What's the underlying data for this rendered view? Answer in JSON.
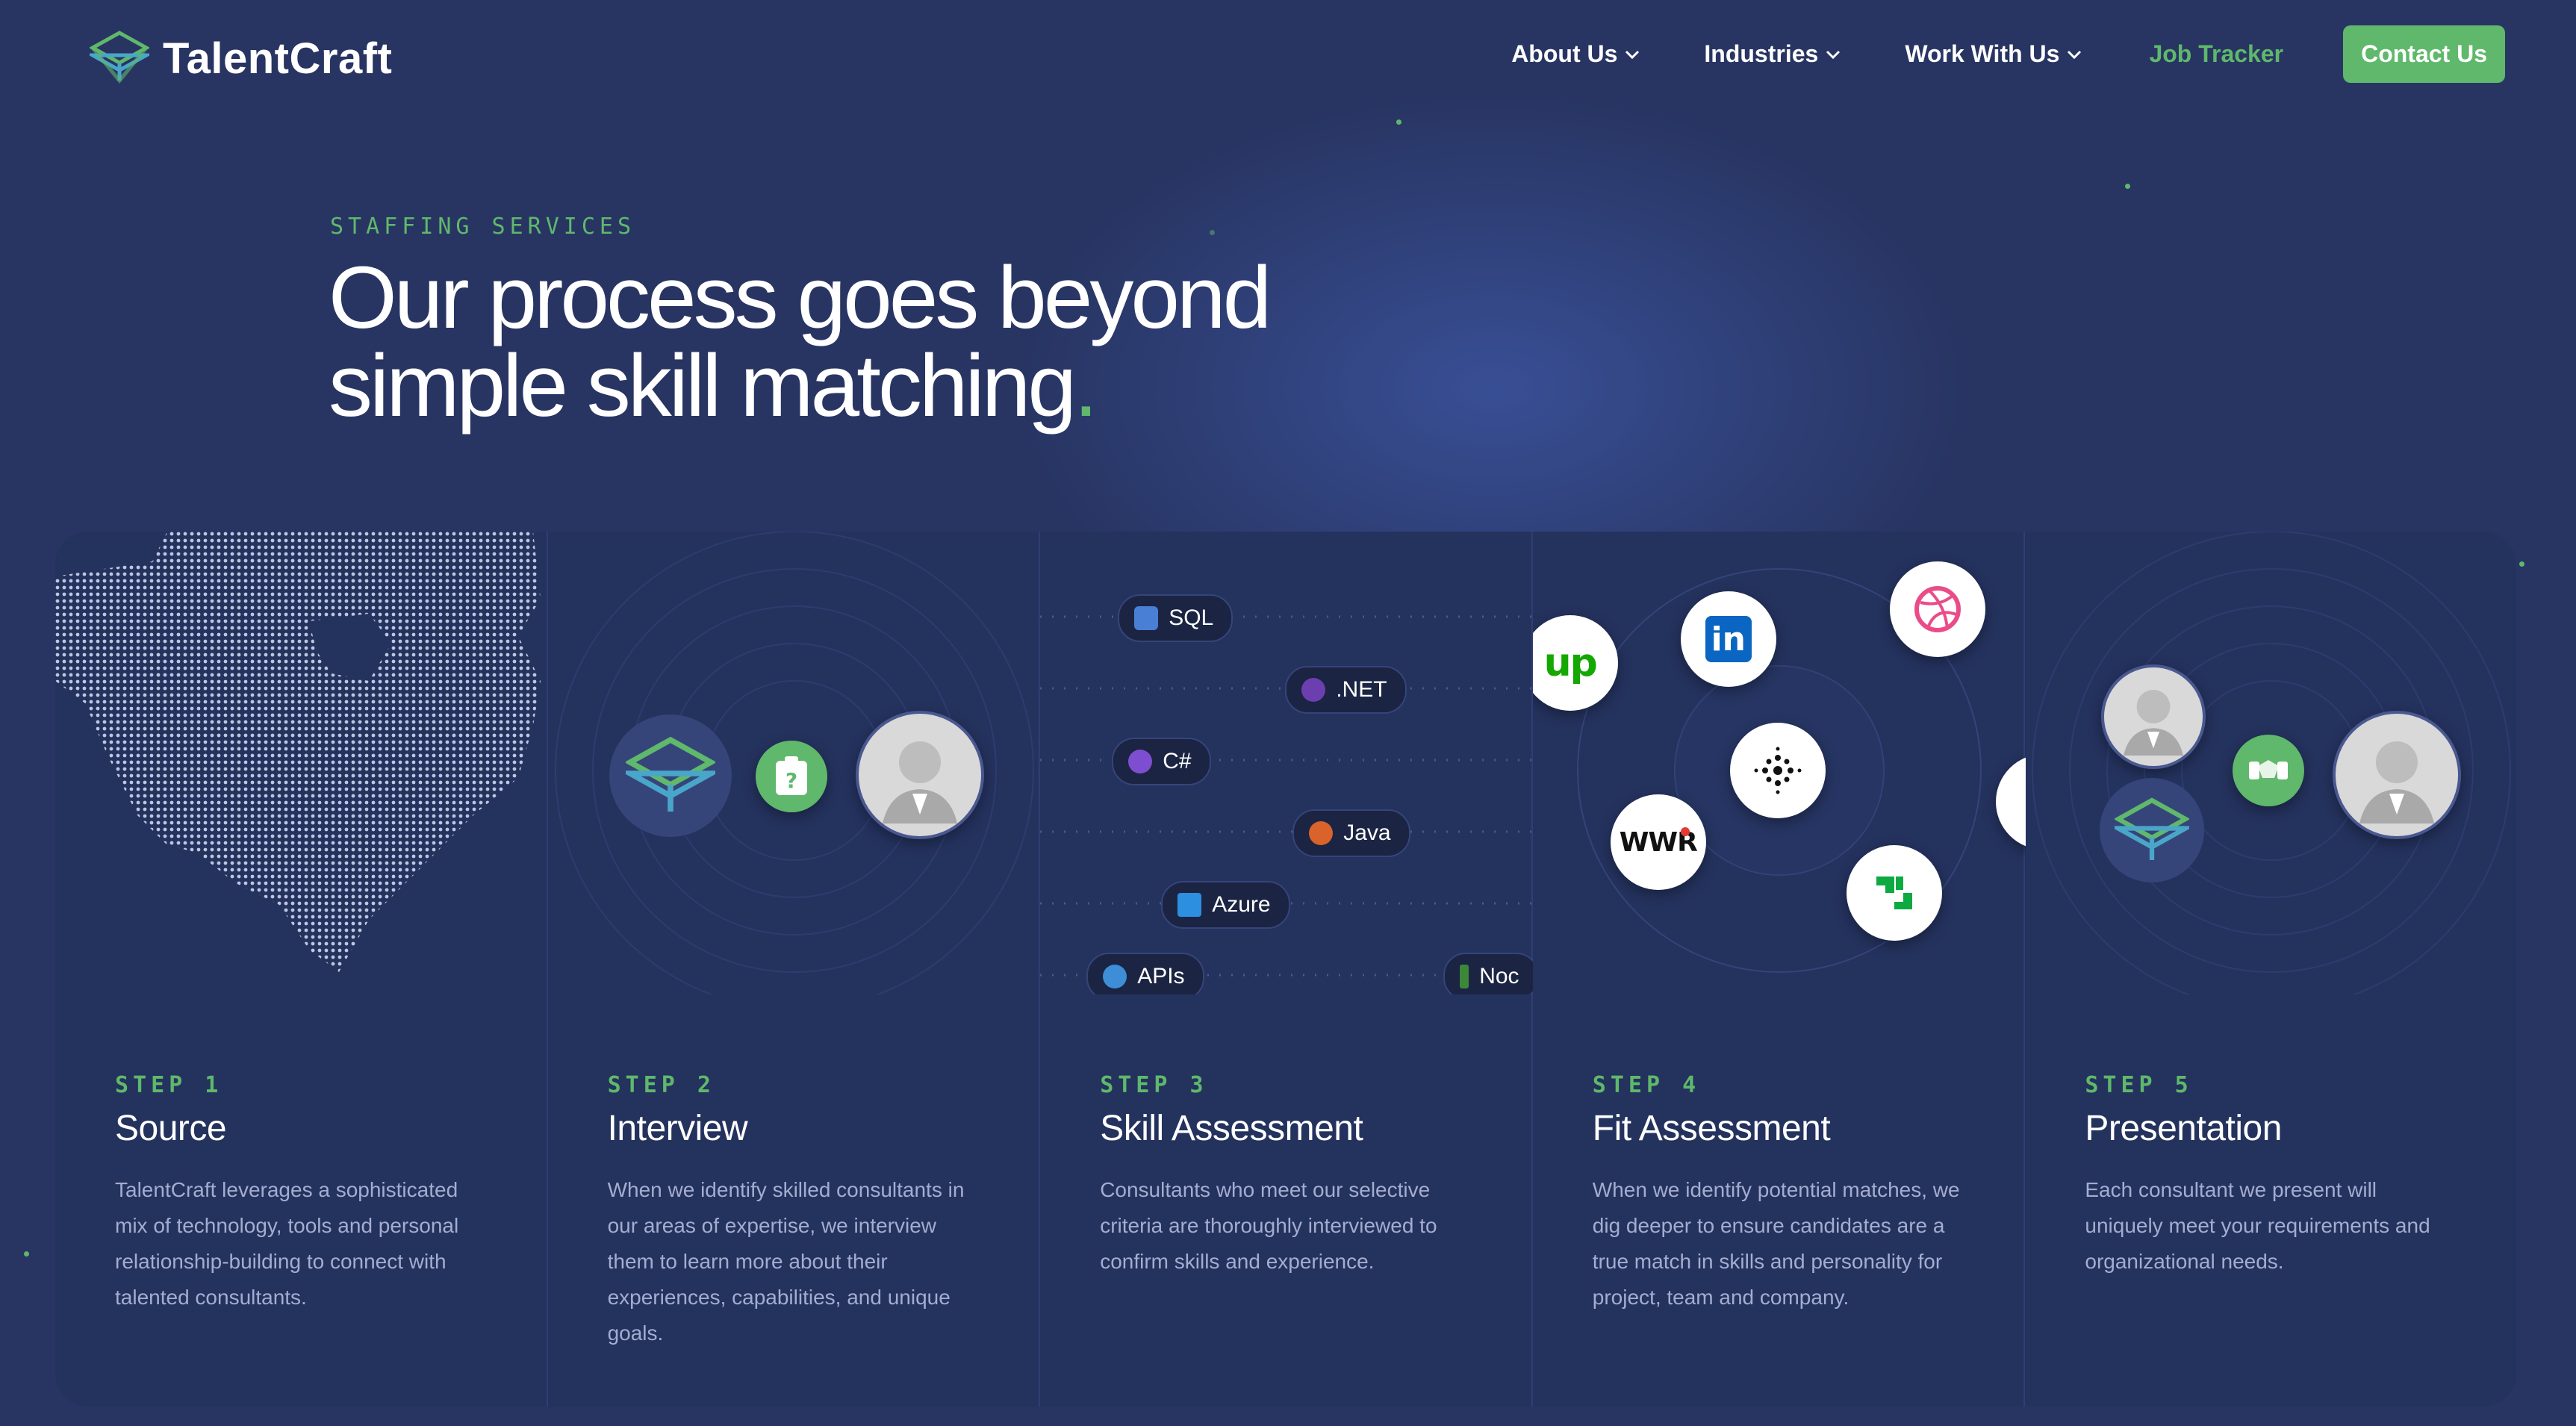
{
  "brand": {
    "name": "TalentCraft"
  },
  "nav": {
    "items": [
      {
        "label": "About Us",
        "has_dropdown": true
      },
      {
        "label": "Industries",
        "has_dropdown": true
      },
      {
        "label": "Work With Us",
        "has_dropdown": true
      }
    ],
    "job_tracker": "Job Tracker",
    "contact": "Contact Us"
  },
  "hero": {
    "eyebrow": "STAFFING SERVICES",
    "headline_line1": "Our process goes beyond",
    "headline_line2": "simple skill matching",
    "headline_period": "."
  },
  "steps": [
    {
      "label": "STEP 1",
      "title": "Source",
      "description": "TalentCraft leverages a sophisticated mix of technology, tools and personal relationship-building to connect with talented consultants."
    },
    {
      "label": "STEP 2",
      "title": "Interview",
      "description": "When we identify skilled consultants in our areas of expertise, we interview them to learn more about their experiences, capabilities, and unique goals."
    },
    {
      "label": "STEP 3",
      "title": "Skill Assessment",
      "description": "Consultants who meet our selective criteria are thoroughly interviewed to confirm skills and experience."
    },
    {
      "label": "STEP 4",
      "title": "Fit Assessment",
      "description": "When we identify potential matches, we dig deeper to ensure candidates are a true match in skills and personality for project, team and company."
    },
    {
      "label": "STEP 5",
      "title": "Presentation",
      "description": "Each consultant we present will uniquely meet your requirements and organizational needs."
    }
  ],
  "skills": [
    {
      "label": "SQL",
      "icon": "database-icon"
    },
    {
      "label": ".NET",
      "icon": "dotnet-icon"
    },
    {
      "label": "C#",
      "icon": "csharp-icon"
    },
    {
      "label": "Java",
      "icon": "java-icon"
    },
    {
      "label": "Azure",
      "icon": "azure-icon"
    },
    {
      "label": "APIs",
      "icon": "api-icon"
    },
    {
      "label": "Noc",
      "icon": "node-icon"
    }
  ],
  "source_logos": [
    {
      "name": "upwork-logo",
      "text": "up"
    },
    {
      "name": "linkedin-logo",
      "text": "in"
    },
    {
      "name": "dribbble-logo",
      "text": ""
    },
    {
      "name": "angellist-logo",
      "text": ""
    },
    {
      "name": "wwr-logo",
      "text": "WWR"
    },
    {
      "name": "glassdoor-logo",
      "text": ""
    }
  ],
  "colors": {
    "background": "#283563",
    "panel": "#24325e",
    "accent_green": "#5fb86b",
    "muted_text": "#a4add0"
  }
}
